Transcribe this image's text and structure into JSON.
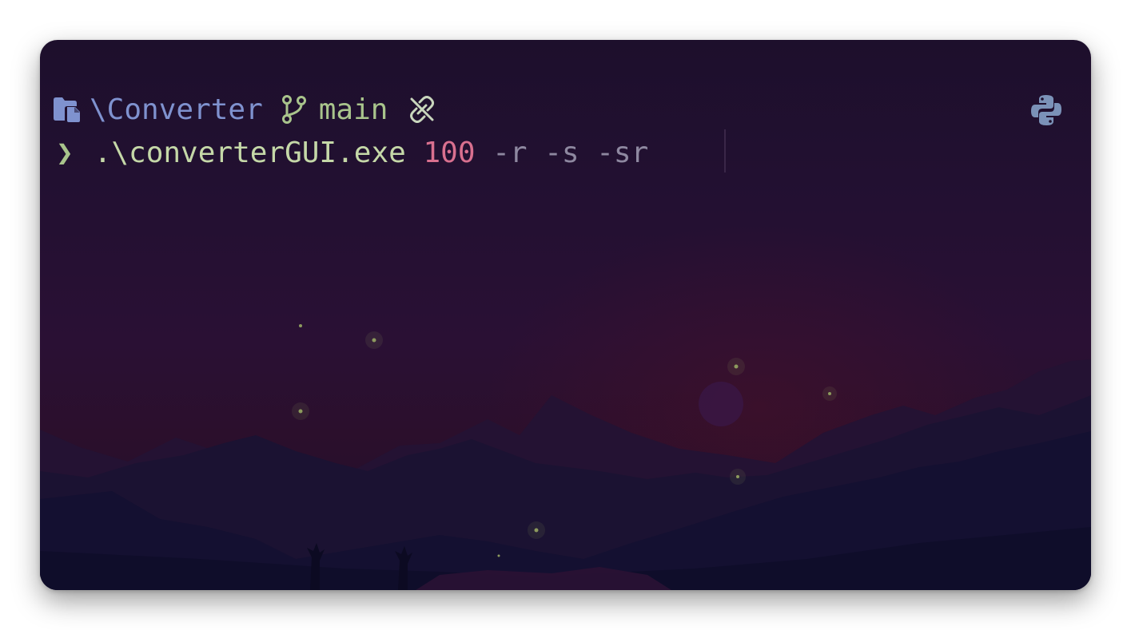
{
  "prompt": {
    "folder_icon": "folder-icon",
    "path": "\\Converter",
    "branch_icon": "git-branch-icon",
    "branch": "main",
    "status_icon": "unlinked-icon",
    "env_icon": "python-icon"
  },
  "command": {
    "symbol": "❯",
    "executable": " .\\converterGUI.exe",
    "argument_number": " 100",
    "flags": " -r -s -sr"
  },
  "colors": {
    "path": "#7f92cf",
    "branch": "#a9c48c",
    "executable": "#c5d8a8",
    "number": "#d9708f",
    "flags": "#8e88a0",
    "python": "#7b92b8"
  }
}
